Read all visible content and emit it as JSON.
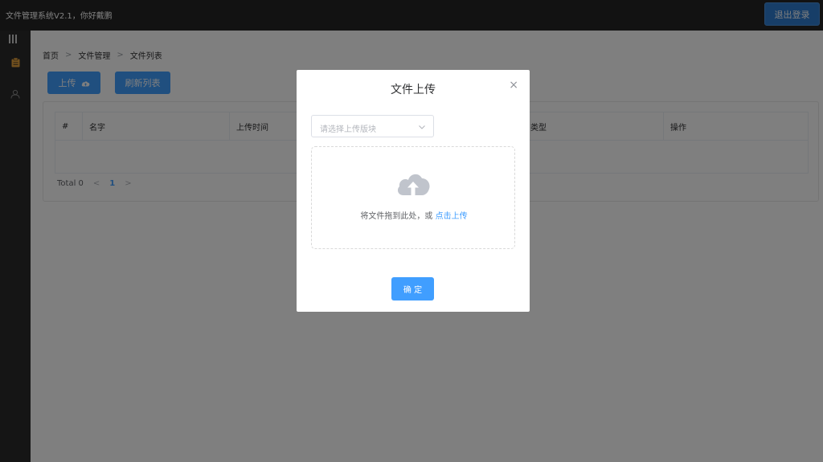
{
  "header": {
    "title": "文件管理系统V2.1，你好戴鹏",
    "logout_label": "退出登录"
  },
  "sidebar": {
    "items": [
      {
        "icon": "clipboard-icon",
        "active": true
      },
      {
        "icon": "user-icon",
        "active": false
      }
    ]
  },
  "breadcrumb": [
    "首页",
    "文件管理",
    "文件列表"
  ],
  "toolbar": {
    "upload_label": "上传",
    "refresh_label": "刷新列表"
  },
  "table": {
    "columns": [
      "#",
      "名字",
      "上传时间",
      "类型",
      "类型",
      "操作"
    ],
    "rows": []
  },
  "pagination": {
    "total_text": "Total 0",
    "current_page": "1"
  },
  "dialog": {
    "title": "文件上传",
    "close_glyph": "×",
    "select_placeholder": "请选择上传版块",
    "drop_text": "将文件拖到此处，或",
    "drop_link": "点击上传",
    "confirm_label": "确 定"
  },
  "colors": {
    "primary": "#409eff",
    "topbar": "#242424",
    "sidebar": "#2a2a2a",
    "overlay": "rgba(0,0,0,0.5)"
  }
}
